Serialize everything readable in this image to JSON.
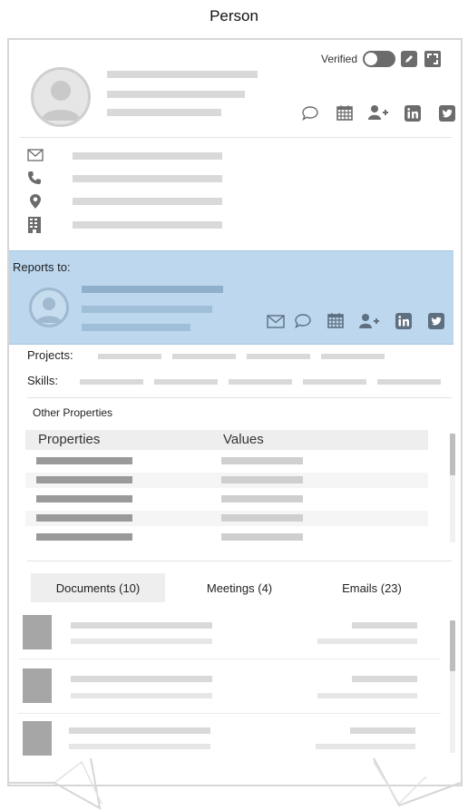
{
  "page_title": "Person",
  "header": {
    "verified_label": "Verified",
    "verified_on": true
  },
  "icons": {
    "edit": "edit-icon",
    "expand": "expand-icon",
    "chat": "chat-bubble-icon",
    "calendar": "calendar-icon",
    "add_person": "add-person-icon",
    "linkedin": "linkedin-icon",
    "twitter": "twitter-icon",
    "mail": "mail-icon",
    "phone": "phone-icon",
    "location": "location-pin-icon",
    "building": "building-icon"
  },
  "reports_to": {
    "label": "Reports to:"
  },
  "projects_label": "Projects:",
  "skills_label": "Skills:",
  "other_properties": {
    "title": "Other Properties",
    "col_properties": "Properties",
    "col_values": "Values"
  },
  "tabs": [
    {
      "label": "Documents (10)",
      "active": true
    },
    {
      "label": "Meetings (4)",
      "active": false
    },
    {
      "label": "Emails (23)",
      "active": false
    }
  ],
  "colors": {
    "highlight": "#bcd7ee",
    "placeholder": "#d9d9d9",
    "icon": "#6b6b6b"
  }
}
